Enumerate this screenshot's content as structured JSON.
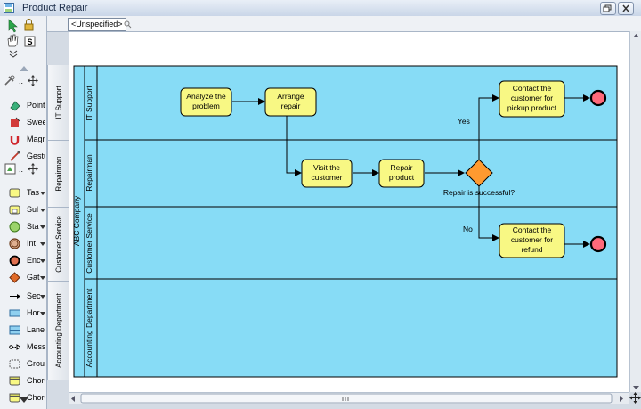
{
  "window": {
    "title": "Product Repair"
  },
  "breadcrumb": {
    "label": "<Unspecified>"
  },
  "palette": {
    "items": [
      {
        "label": "Point",
        "icon": "pointer-icon"
      },
      {
        "label": "Swee",
        "icon": "sweeper-icon"
      },
      {
        "label": "Magn",
        "icon": "magnet-icon"
      },
      {
        "label": "Gestu",
        "icon": "gesture-icon"
      },
      {
        "label": "Tas",
        "icon": "task-icon"
      },
      {
        "label": "Sul",
        "icon": "subprocess-icon"
      },
      {
        "label": "Sta",
        "icon": "start-event-icon"
      },
      {
        "label": "Int",
        "icon": "intermediate-event-icon"
      },
      {
        "label": "Enc",
        "icon": "end-event-icon"
      },
      {
        "label": "Gat",
        "icon": "gateway-icon"
      },
      {
        "label": "Sec",
        "icon": "sequence-flow-icon"
      },
      {
        "label": "Hor",
        "icon": "horizontal-pool-icon"
      },
      {
        "label": "Lane",
        "icon": "lane-icon"
      },
      {
        "label": "Messi",
        "icon": "message-flow-icon"
      },
      {
        "label": "Group",
        "icon": "group-icon"
      },
      {
        "label": "Chore",
        "icon": "choreography-icon"
      },
      {
        "label": "Chore",
        "icon": "choreography-icon"
      }
    ]
  },
  "lane_headers": [
    "IT Support",
    "Repairman",
    "Customer Service",
    "Accounting Department"
  ],
  "pool": {
    "name": "ABC Company"
  },
  "lanes": [
    "IT Support",
    "Repairman",
    "Customer Service",
    "Accounting Department"
  ],
  "tasks": {
    "analyze": [
      "Analyze the",
      "problem"
    ],
    "arrange": [
      "Arrange",
      "repair"
    ],
    "visit": [
      "Visit the",
      "customer"
    ],
    "repair": [
      "Repair",
      "product"
    ],
    "pickup": [
      "Contact the",
      "customer for",
      "pickup product"
    ],
    "refund": [
      "Contact the",
      "customer for",
      "refund"
    ]
  },
  "gateway": {
    "label": "Repair is successful?"
  },
  "flows": {
    "yes": "Yes",
    "no": "No"
  },
  "colors": {
    "pool": "#87dcf6",
    "task": "#f8f884",
    "gateway": "#ff9a30",
    "end": "#ff6a7a"
  }
}
